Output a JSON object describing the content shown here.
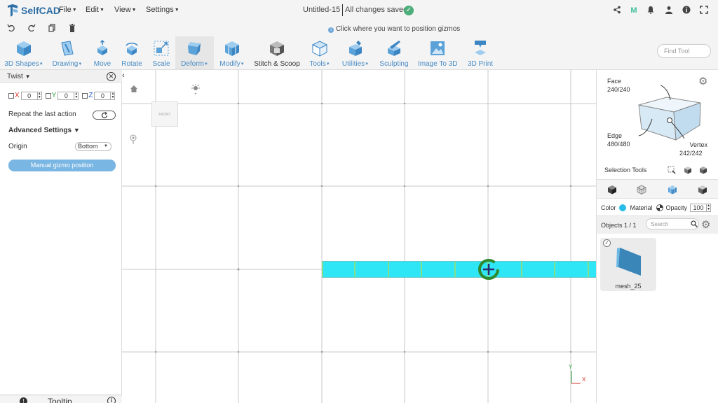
{
  "app": {
    "name": "SelfCAD"
  },
  "menu": [
    {
      "label": "File"
    },
    {
      "label": "Edit"
    },
    {
      "label": "View"
    },
    {
      "label": "Settings"
    }
  ],
  "document": {
    "title": "Untitled-15",
    "status": "All changes saved"
  },
  "hint": "Click where you want to position gizmos",
  "toolbar": {
    "tools": [
      {
        "label": "3D Shapes",
        "icon": "cube-icon"
      },
      {
        "label": "Drawing",
        "icon": "pencil-box-icon"
      },
      {
        "label": "Move",
        "icon": "move-icon"
      },
      {
        "label": "Rotate",
        "icon": "rotate-icon"
      },
      {
        "label": "Scale",
        "icon": "scale-icon"
      },
      {
        "label": "Deform",
        "icon": "deform-icon"
      },
      {
        "label": "Modify",
        "icon": "modify-icon"
      },
      {
        "label": "Stitch & Scoop",
        "icon": "stitch-scoop-icon"
      },
      {
        "label": "Tools",
        "icon": "tools-icon"
      },
      {
        "label": "Utilities",
        "icon": "utilities-icon"
      },
      {
        "label": "Sculpting",
        "icon": "sculpting-icon"
      },
      {
        "label": "Image To 3D",
        "icon": "image-to-3d-icon"
      },
      {
        "label": "3D Print",
        "icon": "3d-print-icon"
      }
    ],
    "find_placeholder": "Find Tool"
  },
  "left_panel": {
    "title": "Twist",
    "axes": [
      {
        "label": "X",
        "value": "0",
        "color": "#d9342b"
      },
      {
        "label": "Y",
        "value": "0",
        "color": "#2a9d3a"
      },
      {
        "label": "Z",
        "value": "0",
        "color": "#2a5fcf"
      }
    ],
    "repeat_label": "Repeat the last action",
    "advanced_label": "Advanced Settings",
    "origin_label": "Origin",
    "origin_value": "Bottom",
    "manual_button": "Manual gizmo position",
    "tooltip_label": "Tooltip"
  },
  "viewport": {
    "view_cube_label": "FRONT",
    "object_color": "#2ee6f5",
    "axis_y": "Y",
    "axis_x": "X"
  },
  "right_panel": {
    "face_label": "Face",
    "face_count": "240/240",
    "edge_label": "Edge",
    "edge_count": "480/480",
    "vertex_label": "Vertex",
    "vertex_count": "242/242",
    "selection_tools_label": "Selection Tools",
    "color_label": "Color",
    "color_value": "#29bde6",
    "material_label": "Material",
    "opacity_label": "Opacity",
    "opacity_value": "100",
    "objects_label": "Objects 1 / 1",
    "search_placeholder": "Search",
    "object_name": "mesh_25"
  }
}
